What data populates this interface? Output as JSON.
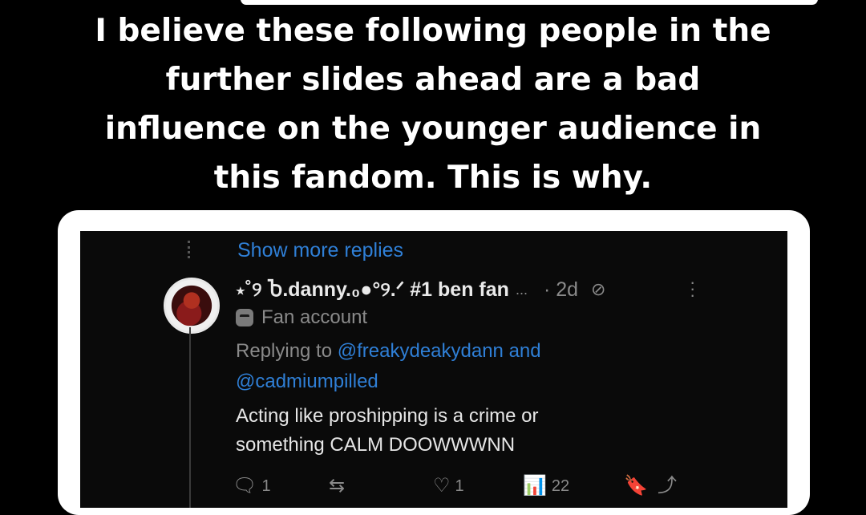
{
  "caption": {
    "line1": "I believe these following people in the",
    "line2": "further slides ahead are a bad",
    "line3": "influence on the younger audience in",
    "line4": "this fandom. This is why."
  },
  "post": {
    "show_more": "Show more replies",
    "display_name": "⋆˚୨ Ⴆ.danny.₀●°୨.ᐟ #1 ben fan",
    "name_ellipsis": "...",
    "time": "· 2d",
    "badge": "Fan account",
    "replying_to_label": "Replying to",
    "mention1": "@freakydeakydann",
    "and_label": "and",
    "mention2": "@cadmiumpilled",
    "text_line1": "Acting like proshipping is a crime or",
    "text_line2": "something CALM DOOWWWNN",
    "reply_count": "1",
    "repost_count": "",
    "like_count": "1",
    "views_count": "22"
  },
  "icons": {
    "reply": "comment-icon",
    "repost": "repost-icon",
    "like": "heart-icon",
    "views": "views-icon",
    "bookmark": "bookmark-icon",
    "share": "share-icon",
    "mute": "no-entry-icon",
    "more": "more-icon"
  },
  "colors": {
    "link": "#2f7fd6",
    "muted": "#8a8a8a",
    "background": "#000000"
  }
}
